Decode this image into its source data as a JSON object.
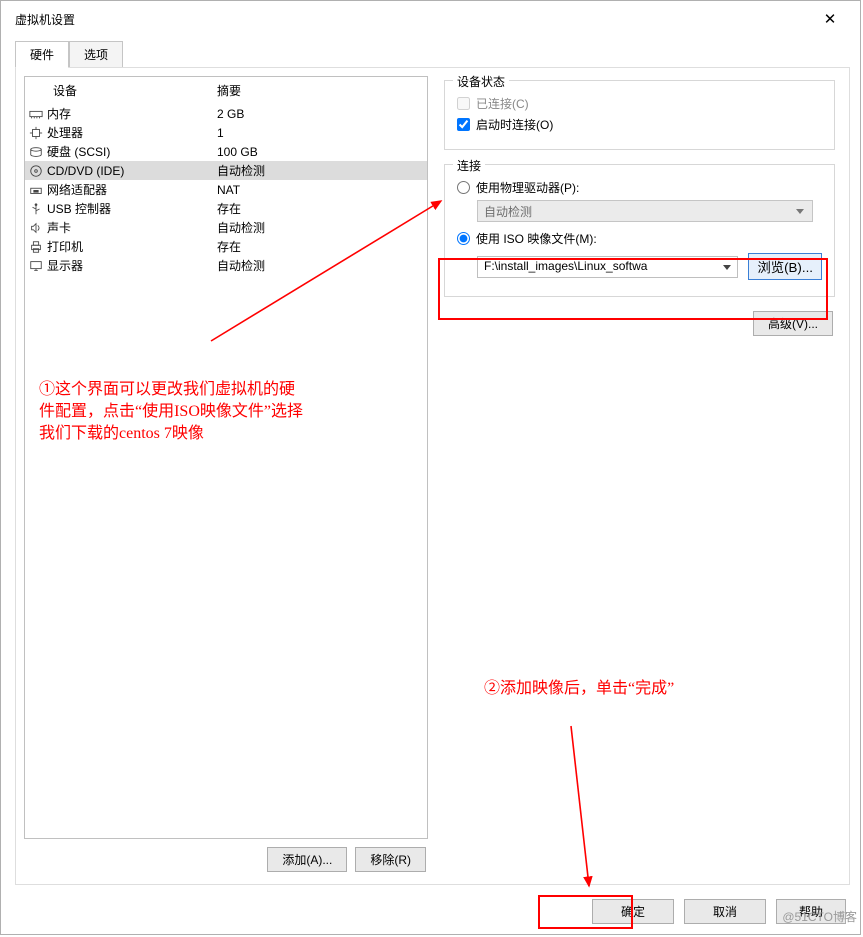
{
  "window": {
    "title": "虚拟机设置"
  },
  "tabs": {
    "hardware": "硬件",
    "options": "选项"
  },
  "hwlist": {
    "header_device": "设备",
    "header_summary": "摘要",
    "rows": [
      {
        "icon": "memory",
        "name": "内存",
        "summary": "2 GB"
      },
      {
        "icon": "cpu",
        "name": "处理器",
        "summary": "1"
      },
      {
        "icon": "disk",
        "name": "硬盘 (SCSI)",
        "summary": "100 GB"
      },
      {
        "icon": "cd",
        "name": "CD/DVD (IDE)",
        "summary": "自动检测"
      },
      {
        "icon": "net",
        "name": "网络适配器",
        "summary": "NAT"
      },
      {
        "icon": "usb",
        "name": "USB 控制器",
        "summary": "存在"
      },
      {
        "icon": "sound",
        "name": "声卡",
        "summary": "自动检测"
      },
      {
        "icon": "printer",
        "name": "打印机",
        "summary": "存在"
      },
      {
        "icon": "display",
        "name": "显示器",
        "summary": "自动检测"
      }
    ],
    "selected_index": 3
  },
  "buttons": {
    "add": "添加(A)...",
    "remove": "移除(R)"
  },
  "right": {
    "status": {
      "legend": "设备状态",
      "connected": "已连接(C)",
      "connect_at_power": "启动时连接(O)"
    },
    "connection": {
      "legend": "连接",
      "use_physical": "使用物理驱动器(P):",
      "auto_detect": "自动检测",
      "use_iso": "使用 ISO 映像文件(M):",
      "iso_path": "F:\\install_images\\Linux_softwa",
      "browse": "浏览(B)..."
    },
    "advanced": "高级(V)..."
  },
  "footer": {
    "ok": "确定",
    "cancel": "取消",
    "help": "帮助"
  },
  "annotations": {
    "a1": "①这个界面可以更改我们虚拟机的硬件配置，点击“使用ISO映像文件”选择我们下载的centos 7映像",
    "a2": "②添加映像后，单击“完成”"
  },
  "watermark": "@51CTO博客"
}
